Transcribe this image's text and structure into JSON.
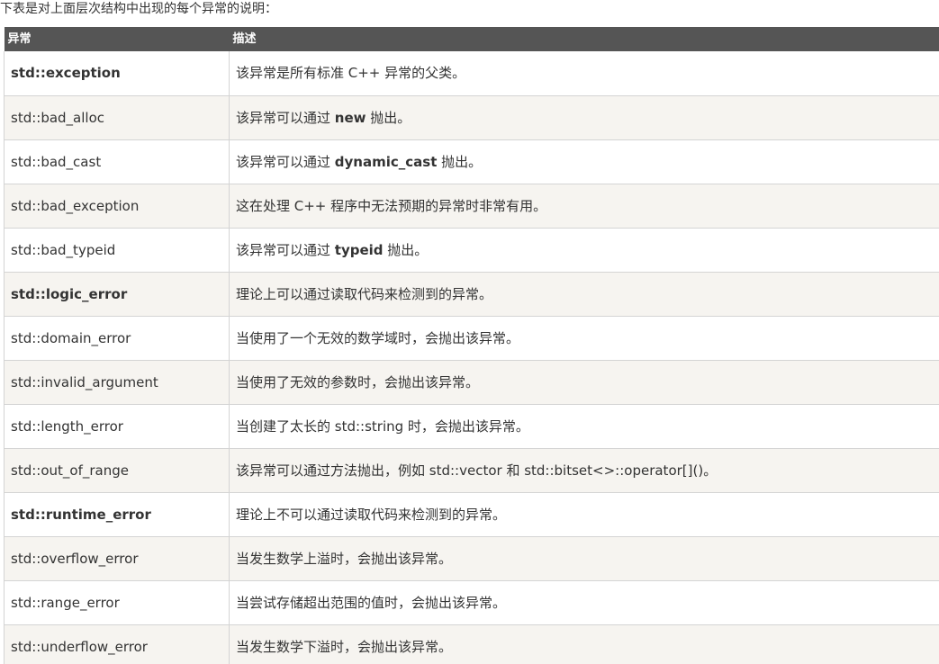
{
  "intro": "下表是对上面层次结构中出现的每个异常的说明：",
  "table": {
    "headers": [
      "异常",
      "描述"
    ],
    "rows": [
      {
        "name": "std::exception",
        "bold": true,
        "desc_pre": "该异常是所有标准 C++ 异常的父类。",
        "keyword": "",
        "desc_post": ""
      },
      {
        "name": "std::bad_alloc",
        "bold": false,
        "desc_pre": "该异常可以通过 ",
        "keyword": "new",
        "desc_post": " 抛出。"
      },
      {
        "name": "std::bad_cast",
        "bold": false,
        "desc_pre": "该异常可以通过 ",
        "keyword": "dynamic_cast",
        "desc_post": " 抛出。"
      },
      {
        "name": "std::bad_exception",
        "bold": false,
        "desc_pre": "这在处理 C++ 程序中无法预期的异常时非常有用。",
        "keyword": "",
        "desc_post": ""
      },
      {
        "name": "std::bad_typeid",
        "bold": false,
        "desc_pre": "该异常可以通过 ",
        "keyword": "typeid",
        "desc_post": " 抛出。"
      },
      {
        "name": "std::logic_error",
        "bold": true,
        "desc_pre": "理论上可以通过读取代码来检测到的异常。",
        "keyword": "",
        "desc_post": ""
      },
      {
        "name": "std::domain_error",
        "bold": false,
        "desc_pre": "当使用了一个无效的数学域时，会抛出该异常。",
        "keyword": "",
        "desc_post": ""
      },
      {
        "name": "std::invalid_argument",
        "bold": false,
        "desc_pre": "当使用了无效的参数时，会抛出该异常。",
        "keyword": "",
        "desc_post": ""
      },
      {
        "name": "std::length_error",
        "bold": false,
        "desc_pre": "当创建了太长的 std::string 时，会抛出该异常。",
        "keyword": "",
        "desc_post": ""
      },
      {
        "name": "std::out_of_range",
        "bold": false,
        "desc_pre": "该异常可以通过方法抛出，例如 std::vector 和 std::bitset<>::operator[]()。",
        "keyword": "",
        "desc_post": ""
      },
      {
        "name": "std::runtime_error",
        "bold": true,
        "desc_pre": "理论上不可以通过读取代码来检测到的异常。",
        "keyword": "",
        "desc_post": ""
      },
      {
        "name": "std::overflow_error",
        "bold": false,
        "desc_pre": "当发生数学上溢时，会抛出该异常。",
        "keyword": "",
        "desc_post": ""
      },
      {
        "name": "std::range_error",
        "bold": false,
        "desc_pre": "当尝试存储超出范围的值时，会抛出该异常。",
        "keyword": "",
        "desc_post": ""
      },
      {
        "name": "std::underflow_error",
        "bold": false,
        "desc_pre": "当发生数学下溢时，会抛出该异常。",
        "keyword": "",
        "desc_post": ""
      }
    ]
  }
}
